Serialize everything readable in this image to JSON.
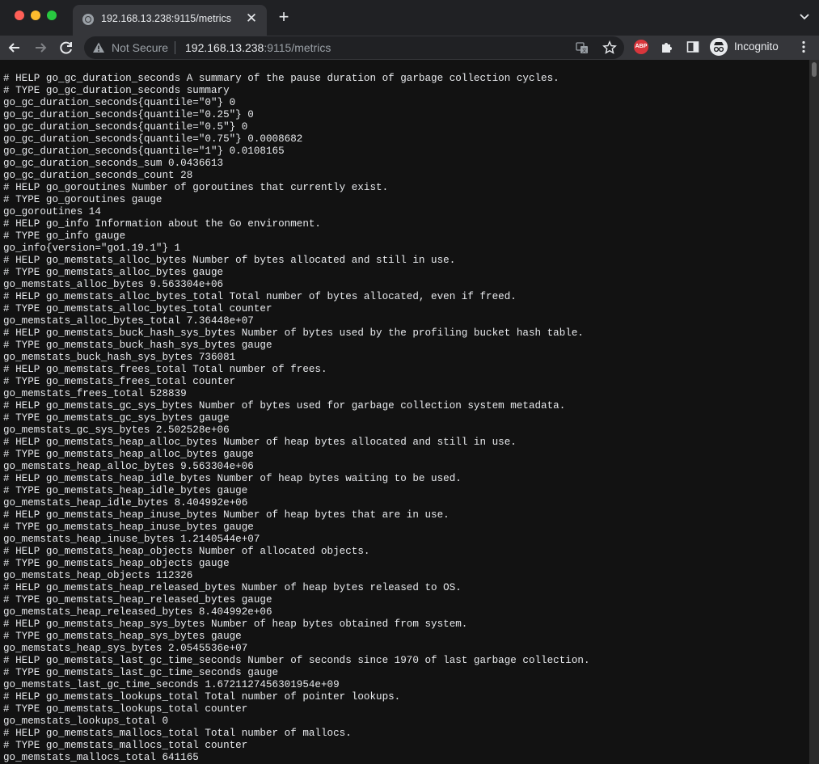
{
  "browser": {
    "tab_title": "192.168.13.238:9115/metrics",
    "url_security": "Not Secure",
    "url_host": "192.168.13.238",
    "url_rest": ":9115/metrics",
    "extension_abp": "ABP",
    "profile_label": "Incognito"
  },
  "icons": {
    "tab_favicon": "globe-icon",
    "close": "close-icon",
    "new_tab": "plus-icon",
    "tab_search": "chevron-down-icon",
    "back": "arrow-left-icon",
    "forward": "arrow-right-icon",
    "reload": "reload-icon",
    "warning": "warning-icon",
    "translate": "translate-icon",
    "bookmark": "star-icon",
    "extensions": "puzzle-icon",
    "side_panel": "side-panel-icon",
    "incognito": "incognito-icon",
    "menu": "kebab-menu-icon"
  },
  "colors": {
    "page_bg": "#121212",
    "text": "#e8eaed",
    "toolbar": "#35363a",
    "tabstrip": "#202124"
  },
  "metrics_lines": [
    "# HELP go_gc_duration_seconds A summary of the pause duration of garbage collection cycles.",
    "# TYPE go_gc_duration_seconds summary",
    "go_gc_duration_seconds{quantile=\"0\"} 0",
    "go_gc_duration_seconds{quantile=\"0.25\"} 0",
    "go_gc_duration_seconds{quantile=\"0.5\"} 0",
    "go_gc_duration_seconds{quantile=\"0.75\"} 0.0008682",
    "go_gc_duration_seconds{quantile=\"1\"} 0.0108165",
    "go_gc_duration_seconds_sum 0.0436613",
    "go_gc_duration_seconds_count 28",
    "# HELP go_goroutines Number of goroutines that currently exist.",
    "# TYPE go_goroutines gauge",
    "go_goroutines 14",
    "# HELP go_info Information about the Go environment.",
    "# TYPE go_info gauge",
    "go_info{version=\"go1.19.1\"} 1",
    "# HELP go_memstats_alloc_bytes Number of bytes allocated and still in use.",
    "# TYPE go_memstats_alloc_bytes gauge",
    "go_memstats_alloc_bytes 9.563304e+06",
    "# HELP go_memstats_alloc_bytes_total Total number of bytes allocated, even if freed.",
    "# TYPE go_memstats_alloc_bytes_total counter",
    "go_memstats_alloc_bytes_total 7.36448e+07",
    "# HELP go_memstats_buck_hash_sys_bytes Number of bytes used by the profiling bucket hash table.",
    "# TYPE go_memstats_buck_hash_sys_bytes gauge",
    "go_memstats_buck_hash_sys_bytes 736081",
    "# HELP go_memstats_frees_total Total number of frees.",
    "# TYPE go_memstats_frees_total counter",
    "go_memstats_frees_total 528839",
    "# HELP go_memstats_gc_sys_bytes Number of bytes used for garbage collection system metadata.",
    "# TYPE go_memstats_gc_sys_bytes gauge",
    "go_memstats_gc_sys_bytes 2.502528e+06",
    "# HELP go_memstats_heap_alloc_bytes Number of heap bytes allocated and still in use.",
    "# TYPE go_memstats_heap_alloc_bytes gauge",
    "go_memstats_heap_alloc_bytes 9.563304e+06",
    "# HELP go_memstats_heap_idle_bytes Number of heap bytes waiting to be used.",
    "# TYPE go_memstats_heap_idle_bytes gauge",
    "go_memstats_heap_idle_bytes 8.404992e+06",
    "# HELP go_memstats_heap_inuse_bytes Number of heap bytes that are in use.",
    "# TYPE go_memstats_heap_inuse_bytes gauge",
    "go_memstats_heap_inuse_bytes 1.2140544e+07",
    "# HELP go_memstats_heap_objects Number of allocated objects.",
    "# TYPE go_memstats_heap_objects gauge",
    "go_memstats_heap_objects 112326",
    "# HELP go_memstats_heap_released_bytes Number of heap bytes released to OS.",
    "# TYPE go_memstats_heap_released_bytes gauge",
    "go_memstats_heap_released_bytes 8.404992e+06",
    "# HELP go_memstats_heap_sys_bytes Number of heap bytes obtained from system.",
    "# TYPE go_memstats_heap_sys_bytes gauge",
    "go_memstats_heap_sys_bytes 2.0545536e+07",
    "# HELP go_memstats_last_gc_time_seconds Number of seconds since 1970 of last garbage collection.",
    "# TYPE go_memstats_last_gc_time_seconds gauge",
    "go_memstats_last_gc_time_seconds 1.6721127456301954e+09",
    "# HELP go_memstats_lookups_total Total number of pointer lookups.",
    "# TYPE go_memstats_lookups_total counter",
    "go_memstats_lookups_total 0",
    "# HELP go_memstats_mallocs_total Total number of mallocs.",
    "# TYPE go_memstats_mallocs_total counter",
    "go_memstats_mallocs_total 641165"
  ]
}
